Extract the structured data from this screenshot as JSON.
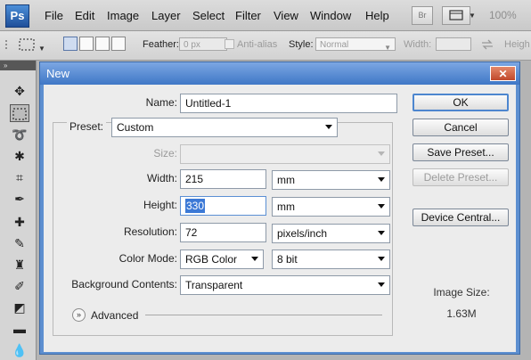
{
  "menubar": {
    "logo": "Ps",
    "items": [
      "File",
      "Edit",
      "Image",
      "Layer",
      "Select",
      "Filter",
      "View",
      "Window",
      "Help"
    ],
    "bridge_label": "Br",
    "zoom": "100%"
  },
  "options": {
    "feather_label": "Feather:",
    "feather_value": "0 px",
    "antialias_label": "Anti-alias",
    "style_label": "Style:",
    "style_value": "Normal",
    "width_label": "Width:",
    "height_label": "Heigh"
  },
  "dialog": {
    "title": "New",
    "name_label": "Name:",
    "name_value": "Untitled-1",
    "preset_label": "Preset:",
    "preset_value": "Custom",
    "size_label": "Size:",
    "width_label": "Width:",
    "width_value": "215",
    "width_unit": "mm",
    "height_label": "Height:",
    "height_value": "330",
    "height_unit": "mm",
    "resolution_label": "Resolution:",
    "resolution_value": "72",
    "resolution_unit": "pixels/inch",
    "color_mode_label": "Color Mode:",
    "color_mode_value": "RGB Color",
    "bit_depth_value": "8 bit",
    "background_label": "Background Contents:",
    "background_value": "Transparent",
    "advanced_label": "Advanced",
    "image_size_label": "Image Size:",
    "image_size_value": "1.63M",
    "buttons": {
      "ok": "OK",
      "cancel": "Cancel",
      "save_preset": "Save Preset...",
      "delete_preset": "Delete Preset...",
      "device_central": "Device Central..."
    }
  },
  "colors": {
    "title_bar": "#3f77c6",
    "highlight": "#3c79d6",
    "close_button": "#c0482b"
  }
}
